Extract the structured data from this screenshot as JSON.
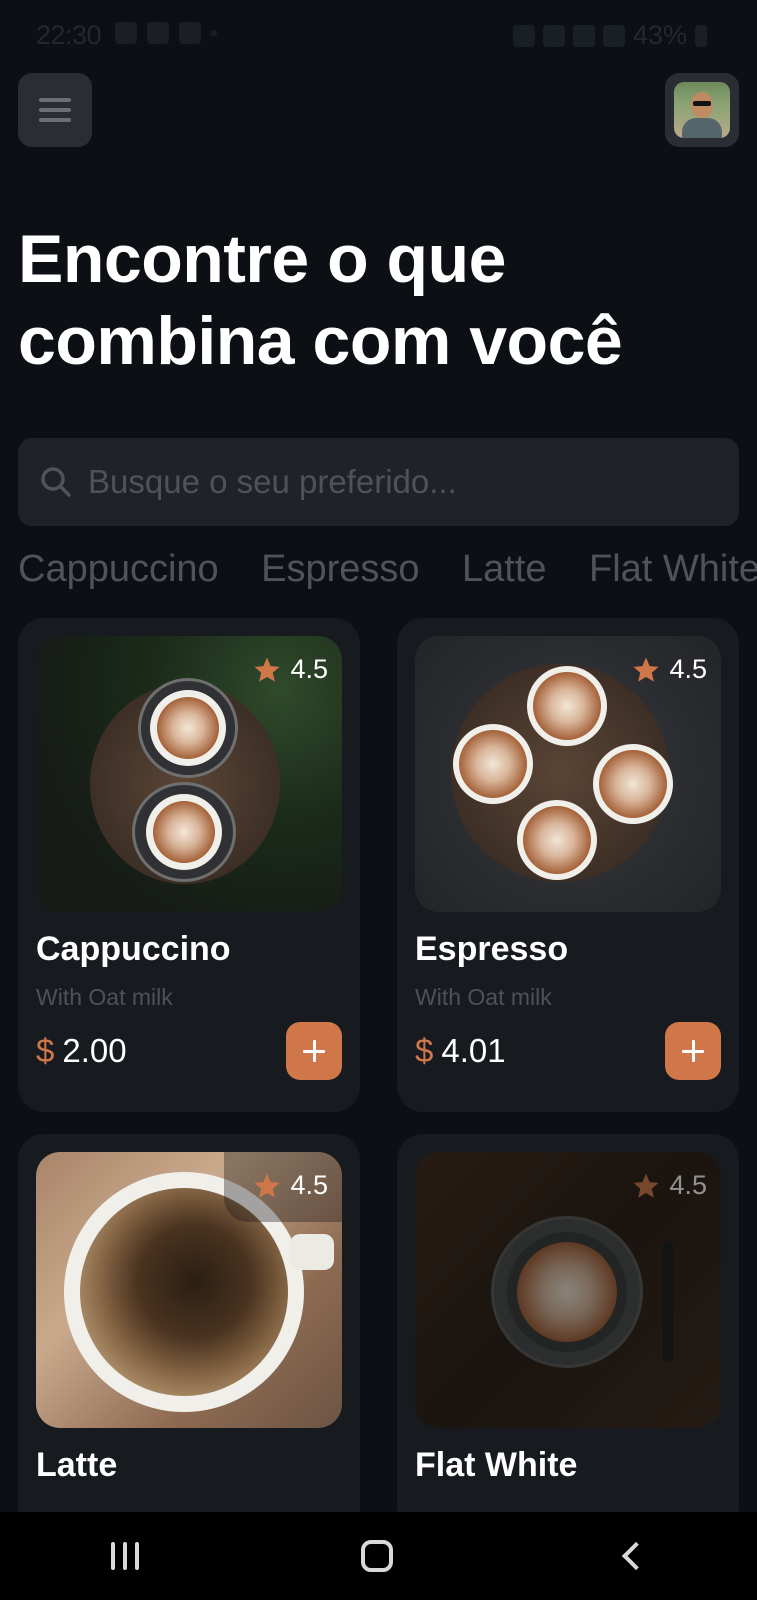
{
  "status_bar": {
    "time": "22:30",
    "battery": "43%"
  },
  "header": {
    "title": "Encontre o que combina com você"
  },
  "search": {
    "placeholder": "Busque o seu preferido..."
  },
  "categories": [
    "Cappuccino",
    "Espresso",
    "Latte",
    "Flat White"
  ],
  "products": [
    {
      "name": "Cappuccino",
      "subtitle": "With Oat milk",
      "currency": "$",
      "price": "2.00",
      "rating": "4.5"
    },
    {
      "name": "Espresso",
      "subtitle": "With Oat milk",
      "currency": "$",
      "price": "4.01",
      "rating": "4.5"
    },
    {
      "name": "Latte",
      "subtitle": "",
      "currency": "$",
      "price": "",
      "rating": "4.5"
    },
    {
      "name": "Flat White",
      "subtitle": "",
      "currency": "$",
      "price": "",
      "rating": "4.5"
    }
  ],
  "colors": {
    "accent": "#d0774a",
    "background": "#0c0f14",
    "card": "#171a1f"
  },
  "icons": [
    "menu-icon",
    "search-icon",
    "star-icon",
    "plus-icon",
    "nav-recent-icon",
    "nav-home-icon",
    "nav-back-icon"
  ]
}
